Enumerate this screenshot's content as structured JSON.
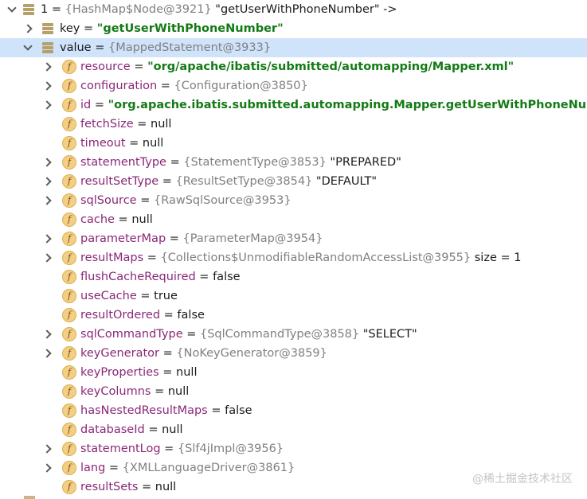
{
  "rows": [
    {
      "level": 0,
      "expandable": true,
      "expanded": true,
      "icon": "stack-icon",
      "name": "1",
      "eq": " = ",
      "ref": "{HashMap$Node@3921}",
      "value": " \"getUserWithPhoneNumber\" ->",
      "valueStyle": "plain"
    },
    {
      "level": 1,
      "expandable": true,
      "expanded": false,
      "icon": "stack-icon",
      "name": "key",
      "eq": " = ",
      "ref": "",
      "value": "\"getUserWithPhoneNumber\"",
      "valueStyle": "str"
    },
    {
      "level": 1,
      "expandable": true,
      "expanded": true,
      "selected": true,
      "icon": "stack-icon",
      "name": "value",
      "eq": " = ",
      "ref": "{MappedStatement@3933}",
      "value": "",
      "valueStyle": "plain"
    },
    {
      "level": 2,
      "expandable": true,
      "icon": "field-icon",
      "name": "resource",
      "eq": " = ",
      "ref": "",
      "value": "\"org/apache/ibatis/submitted/automapping/Mapper.xml\"",
      "valueStyle": "str"
    },
    {
      "level": 2,
      "expandable": true,
      "icon": "field-icon",
      "name": "configuration",
      "eq": " = ",
      "ref": "{Configuration@3850}",
      "value": "",
      "valueStyle": "plain"
    },
    {
      "level": 2,
      "expandable": true,
      "icon": "field-icon",
      "name": "id",
      "eq": " = ",
      "ref": "",
      "value": "\"org.apache.ibatis.submitted.automapping.Mapper.getUserWithPhoneNumber\"",
      "valueStyle": "str"
    },
    {
      "level": 2,
      "expandable": false,
      "icon": "field-icon",
      "name": "fetchSize",
      "eq": " = ",
      "ref": "",
      "value": "null",
      "valueStyle": "plain"
    },
    {
      "level": 2,
      "expandable": false,
      "icon": "field-icon",
      "name": "timeout",
      "eq": " = ",
      "ref": "",
      "value": "null",
      "valueStyle": "plain"
    },
    {
      "level": 2,
      "expandable": true,
      "icon": "field-icon",
      "name": "statementType",
      "eq": " = ",
      "ref": "{StatementType@3853}",
      "value": " \"PREPARED\"",
      "valueStyle": "plain"
    },
    {
      "level": 2,
      "expandable": true,
      "icon": "field-icon",
      "name": "resultSetType",
      "eq": " = ",
      "ref": "{ResultSetType@3854}",
      "value": " \"DEFAULT\"",
      "valueStyle": "plain"
    },
    {
      "level": 2,
      "expandable": true,
      "icon": "field-icon",
      "name": "sqlSource",
      "eq": " = ",
      "ref": "{RawSqlSource@3953}",
      "value": "",
      "valueStyle": "plain"
    },
    {
      "level": 2,
      "expandable": false,
      "icon": "field-icon",
      "name": "cache",
      "eq": " = ",
      "ref": "",
      "value": "null",
      "valueStyle": "plain"
    },
    {
      "level": 2,
      "expandable": true,
      "icon": "field-icon",
      "name": "parameterMap",
      "eq": " = ",
      "ref": "{ParameterMap@3954}",
      "value": "",
      "valueStyle": "plain"
    },
    {
      "level": 2,
      "expandable": true,
      "icon": "field-icon",
      "name": "resultMaps",
      "eq": " = ",
      "ref": "{Collections$UnmodifiableRandomAccessList@3955}",
      "value": "  size = 1",
      "valueStyle": "plain"
    },
    {
      "level": 2,
      "expandable": false,
      "icon": "field-icon",
      "name": "flushCacheRequired",
      "eq": " = ",
      "ref": "",
      "value": "false",
      "valueStyle": "plain"
    },
    {
      "level": 2,
      "expandable": false,
      "icon": "field-icon",
      "name": "useCache",
      "eq": " = ",
      "ref": "",
      "value": "true",
      "valueStyle": "plain"
    },
    {
      "level": 2,
      "expandable": false,
      "icon": "field-icon",
      "name": "resultOrdered",
      "eq": " = ",
      "ref": "",
      "value": "false",
      "valueStyle": "plain"
    },
    {
      "level": 2,
      "expandable": true,
      "icon": "field-icon",
      "name": "sqlCommandType",
      "eq": " = ",
      "ref": "{SqlCommandType@3858}",
      "value": " \"SELECT\"",
      "valueStyle": "plain"
    },
    {
      "level": 2,
      "expandable": true,
      "icon": "field-icon",
      "name": "keyGenerator",
      "eq": " = ",
      "ref": "{NoKeyGenerator@3859}",
      "value": "",
      "valueStyle": "plain"
    },
    {
      "level": 2,
      "expandable": false,
      "icon": "field-icon",
      "name": "keyProperties",
      "eq": " = ",
      "ref": "",
      "value": "null",
      "valueStyle": "plain"
    },
    {
      "level": 2,
      "expandable": false,
      "icon": "field-icon",
      "name": "keyColumns",
      "eq": " = ",
      "ref": "",
      "value": "null",
      "valueStyle": "plain"
    },
    {
      "level": 2,
      "expandable": false,
      "icon": "field-icon",
      "name": "hasNestedResultMaps",
      "eq": " = ",
      "ref": "",
      "value": "false",
      "valueStyle": "plain"
    },
    {
      "level": 2,
      "expandable": false,
      "icon": "field-icon",
      "name": "databaseId",
      "eq": " = ",
      "ref": "",
      "value": "null",
      "valueStyle": "plain"
    },
    {
      "level": 2,
      "expandable": true,
      "icon": "field-icon",
      "name": "statementLog",
      "eq": " = ",
      "ref": "{Slf4jImpl@3956}",
      "value": "",
      "valueStyle": "plain"
    },
    {
      "level": 2,
      "expandable": true,
      "icon": "field-icon",
      "name": "lang",
      "eq": " = ",
      "ref": "{XMLLanguageDriver@3861}",
      "value": "",
      "valueStyle": "plain"
    },
    {
      "level": 2,
      "expandable": false,
      "icon": "field-icon",
      "name": "resultSets",
      "eq": " = ",
      "ref": "",
      "value": "null",
      "valueStyle": "plain"
    }
  ],
  "field_icon_glyph": "f",
  "watermark": "@稀土掘金技术社区",
  "colors": {
    "field_name": "#8a2877",
    "string_value": "#137a16",
    "object_ref": "#808080",
    "selection": "#cfe3fb"
  }
}
